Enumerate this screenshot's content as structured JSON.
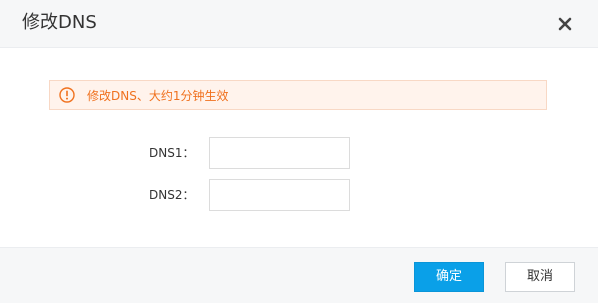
{
  "dialog": {
    "title": "修改DNS",
    "close_icon": "close-icon"
  },
  "notice": {
    "icon": "warning-circle-icon",
    "text": "修改DNS、大约1分钟生效",
    "color": "#f0711e",
    "background": "#fff3ec"
  },
  "form": {
    "dns1": {
      "label": "DNS1：",
      "value": "",
      "placeholder": ""
    },
    "dns2": {
      "label": "DNS2：",
      "value": "",
      "placeholder": ""
    }
  },
  "footer": {
    "confirm_label": "确定",
    "cancel_label": "取消",
    "primary_color": "#0aa0e8"
  }
}
